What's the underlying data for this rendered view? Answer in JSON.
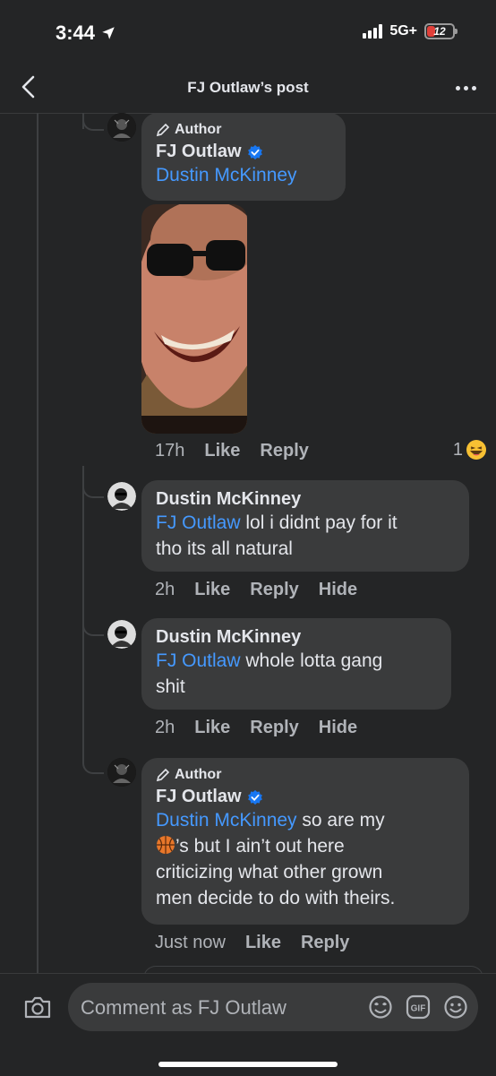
{
  "status_bar": {
    "time": "3:44",
    "network": "5G+",
    "battery": "12"
  },
  "nav": {
    "title": "FJ Outlaw’s post"
  },
  "comments": [
    {
      "author_badge": "Author",
      "name": "FJ Outlaw",
      "verified": true,
      "mention": "Dustin McKinney",
      "text": "",
      "time": "17h",
      "like": "Like",
      "reply": "Reply",
      "reaction_count": "1",
      "reaction_icon": "laughing-emoji"
    },
    {
      "name": "Dustin McKinney",
      "mention": "FJ Outlaw",
      "text_line1": " lol i didnt pay for it",
      "text_line2": "tho its all natural",
      "time": "2h",
      "like": "Like",
      "reply": "Reply",
      "hide": "Hide"
    },
    {
      "name": "Dustin McKinney",
      "mention": "FJ Outlaw",
      "text_line1": " whole lotta gang",
      "text_line2": "shit",
      "time": "2h",
      "like": "Like",
      "reply": "Reply",
      "hide": "Hide"
    },
    {
      "author_badge": "Author",
      "name": "FJ Outlaw",
      "verified": true,
      "mention": "Dustin McKinney",
      "text_line1": " so are my",
      "text_line2": "’s but I ain’t out here",
      "text_line3": "criticizing what other grown",
      "text_line4": "men decide to do with theirs.",
      "inline_icon": "basketball-emoji",
      "time": "Just now",
      "like": "Like",
      "reply": "Reply"
    }
  ],
  "composer": {
    "placeholder": "Comment as FJ Outlaw",
    "icons": [
      "camera-icon",
      "sticker-icon",
      "gif-icon",
      "emoji-icon"
    ],
    "gif_label": "GIF"
  },
  "colors": {
    "background": "#242526",
    "bubble": "#3a3b3c",
    "mention": "#4599ff",
    "verified": "#1877f2"
  }
}
